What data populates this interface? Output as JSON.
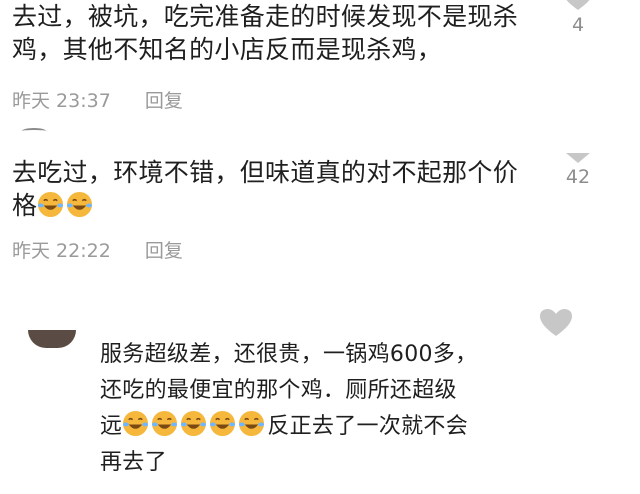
{
  "comments": [
    {
      "lines": [
        "去过，被坑，吃完准备走的时候发现不是现杀",
        "鸡，其他不知名的小店反而是现杀鸡，"
      ],
      "time": "昨天 23:37",
      "reply": "回复",
      "likes": "4"
    },
    {
      "lines": [
        "去吃过，环境不错，但味道真的对不起那个价",
        "格"
      ],
      "time": "昨天 22:22",
      "reply": "回复",
      "likes": "42",
      "emoji": [
        "laughing-crying-emoji",
        "laughing-crying-emoji"
      ]
    },
    {
      "lines": [
        "服务超级差，还很贵，一锅鸡600多，",
        "还吃的最便宜的那个鸡．厕所还超级",
        "远",
        "反正去了一次就不会",
        "再去了"
      ],
      "emoji": [
        "laughing-crying-emoji",
        "laughing-crying-emoji",
        "laughing-crying-emoji",
        "laughing-crying-emoji",
        "laughing-crying-emoji"
      ]
    }
  ],
  "colors": {
    "text": "#1f1f1f",
    "meta": "#9a9a9a",
    "heart": "#c7c7c7",
    "emoji": "#f5b83d"
  }
}
